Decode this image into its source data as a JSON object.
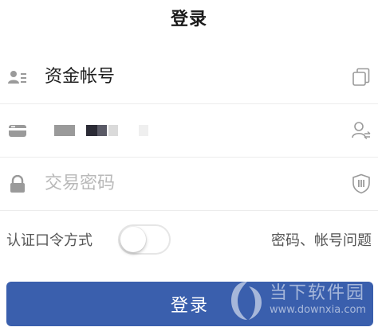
{
  "header": {
    "title": "登录"
  },
  "form": {
    "account": {
      "value": "资金帐号",
      "lead_icon": "id-card-icon",
      "trail_icon": "copy-icon"
    },
    "card": {
      "lead_icon": "bank-card-icon",
      "trail_icon": "switch-user-icon"
    },
    "password": {
      "placeholder": "交易密码",
      "lead_icon": "lock-icon",
      "trail_icon": "security-keyboard-icon"
    }
  },
  "options": {
    "token_label": "认证口令方式",
    "token_enabled": false,
    "help_link": "密码、帐号问题"
  },
  "actions": {
    "login_label": "登录"
  },
  "watermark": {
    "name": "当下软件园",
    "url": "www.downxia.com"
  },
  "colors": {
    "primary": "#3a5fad",
    "placeholder": "#b9b9b9",
    "icon": "#9a9a9a",
    "divider": "#ececec"
  }
}
